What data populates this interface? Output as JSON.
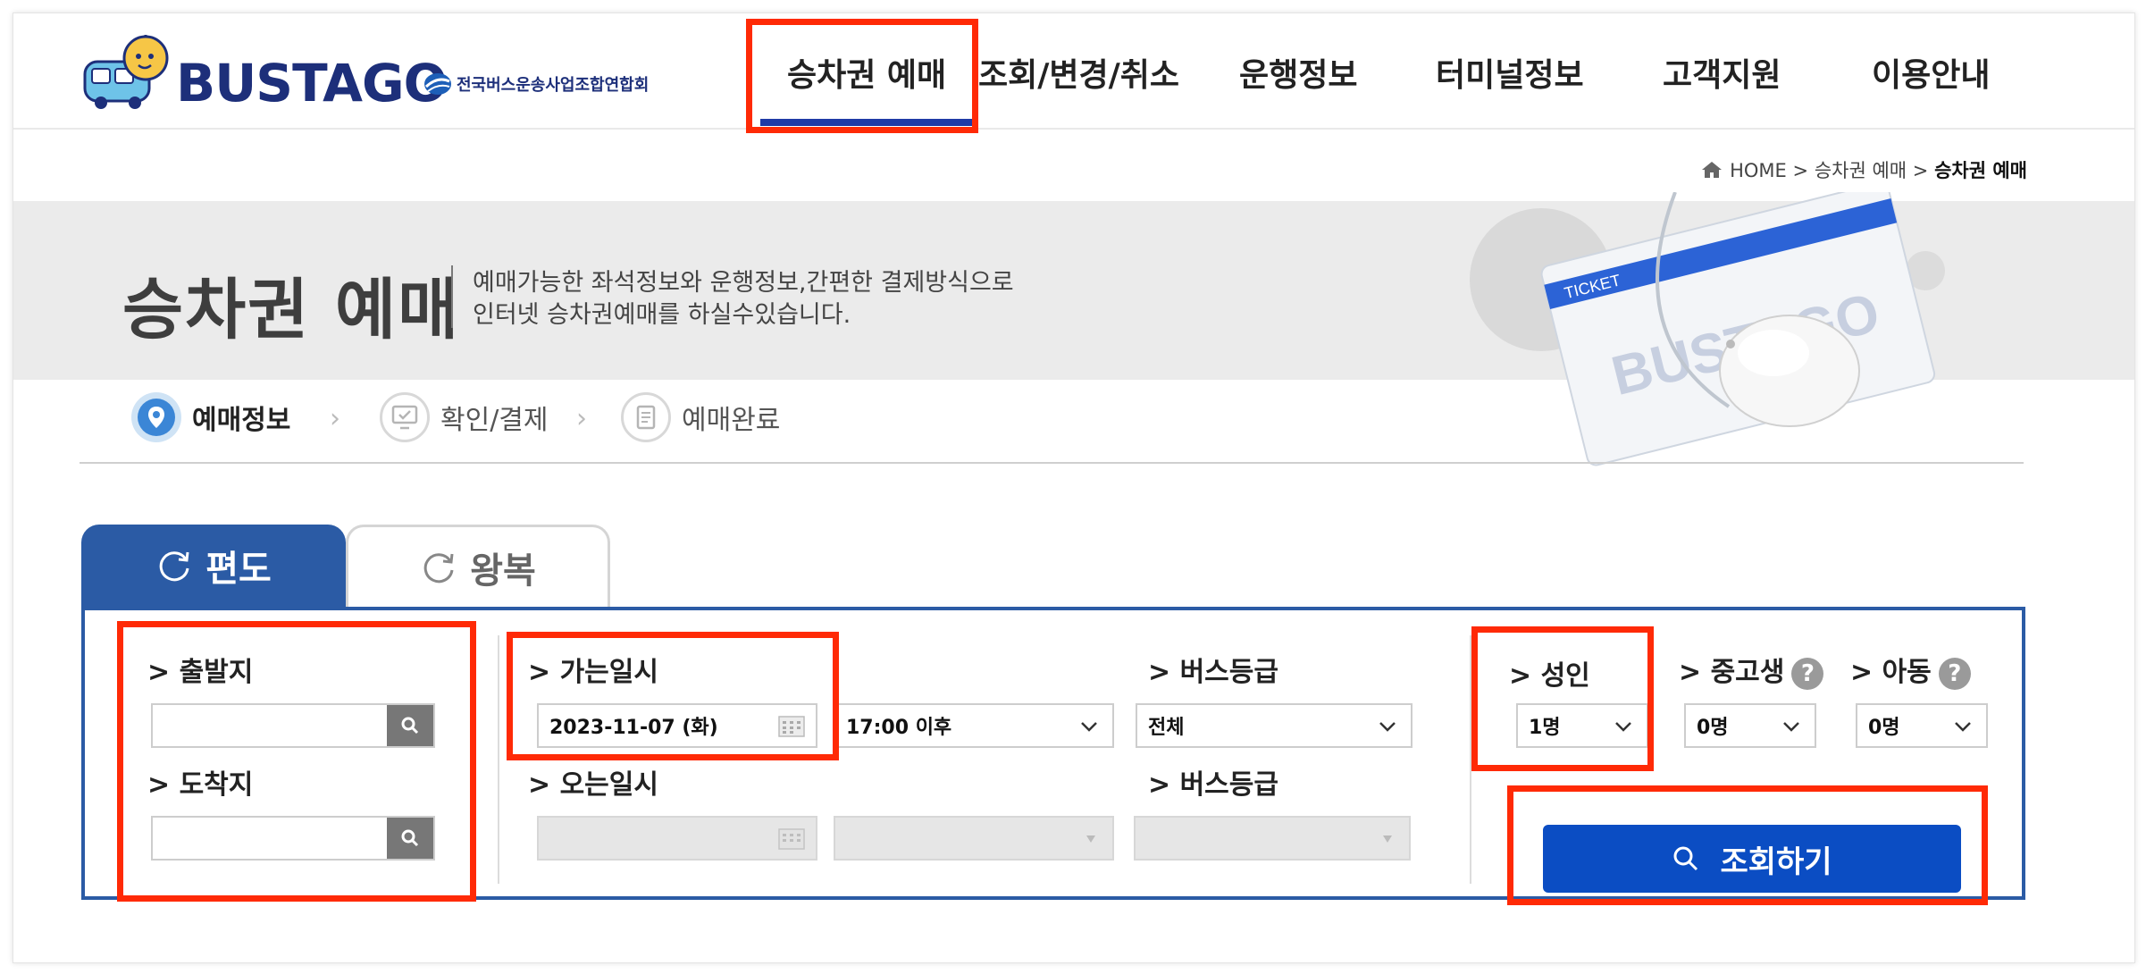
{
  "brand": {
    "logo_text": "BUSTAGO",
    "org_text": "전국버스운송사업조합연합회"
  },
  "nav": {
    "items": [
      {
        "label": "승차권 예매"
      },
      {
        "label": "조회/변경/취소"
      },
      {
        "label": "운행정보"
      },
      {
        "label": "터미널정보"
      },
      {
        "label": "고객지원"
      },
      {
        "label": "이용안내"
      }
    ],
    "active_index": 0
  },
  "breadcrumb": {
    "home": "HOME",
    "sep": ">",
    "section": "승차권 예매",
    "current": "승차권 예매"
  },
  "banner": {
    "title": "승차권 예매",
    "desc_line1": "예매가능한 좌석정보와 운행정보,간편한 결제방식으로",
    "desc_line2": "인터넷 승차권예매를 하실수있습니다.",
    "ticket_text": "TICKET",
    "ticket_brand": "BUSTAGO"
  },
  "steps": [
    {
      "label": "예매정보",
      "icon": "map-pin-icon",
      "active": true
    },
    {
      "label": "확인/결제",
      "icon": "monitor-check-icon",
      "active": false
    },
    {
      "label": "예매완료",
      "icon": "document-icon",
      "active": false
    }
  ],
  "tabs": [
    {
      "label": "편도",
      "active": true
    },
    {
      "label": "왕복",
      "active": false
    }
  ],
  "form": {
    "departure_label": "> 출발지",
    "departure_value": "",
    "arrival_label": "> 도착지",
    "arrival_value": "",
    "go_datetime_label": "> 가는일시",
    "go_date": "2023-11-07 (화)",
    "go_time": "17:00 이후",
    "go_grade_label": "> 버스등급",
    "go_grade": "전체",
    "return_datetime_label": "> 오는일시",
    "return_date": "",
    "return_time": "",
    "return_grade_label": "> 버스등급",
    "return_grade": "",
    "adult_label": "> 성인",
    "adult_value": "1명",
    "student_label": "> 중고생",
    "student_value": "0명",
    "child_label": "> 아동",
    "child_value": "0명",
    "help_glyph": "?",
    "search_button": "조회하기"
  },
  "colors": {
    "brand_navy": "#1d2f7a",
    "tab_active": "#2b5ba5",
    "search_button": "#0b4dc3",
    "highlight": "#ff2a06"
  }
}
